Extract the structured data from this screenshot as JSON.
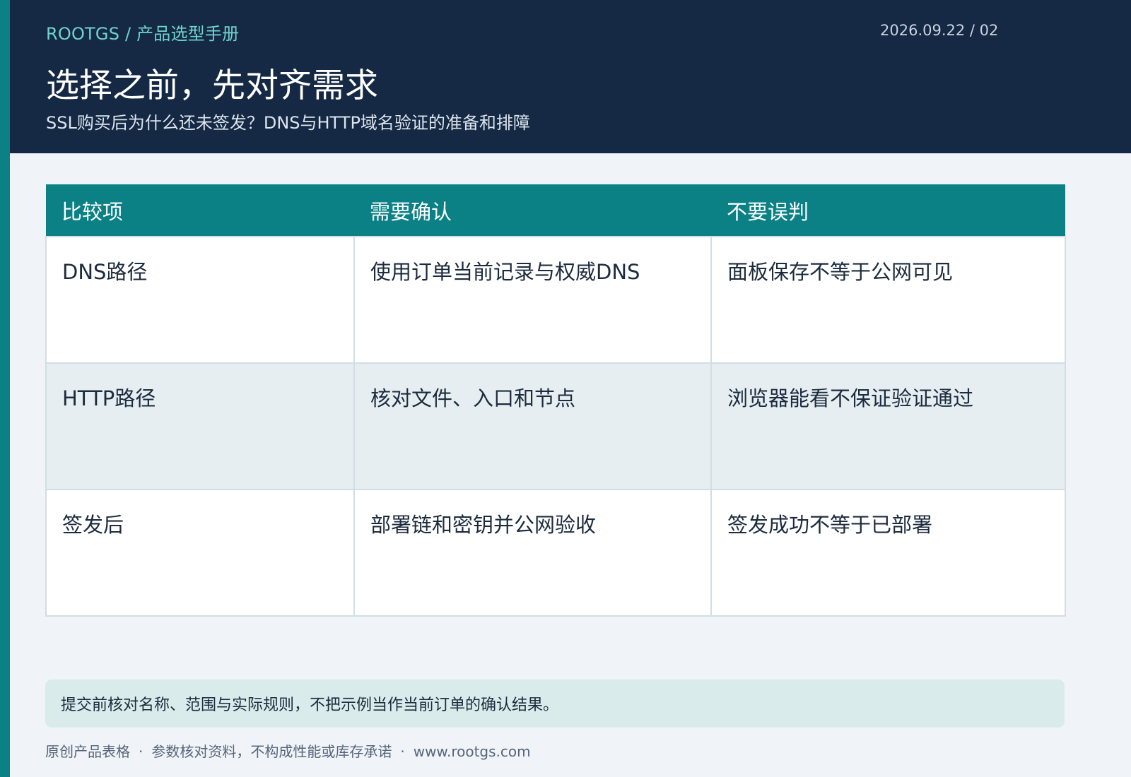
{
  "header": {
    "breadcrumb": "ROOTGS / 产品选型手册",
    "page_index": "2026.09.22 / 02",
    "title": "选择之前，先对齐需求",
    "subtitle": "SSL购买后为什么还未签发？DNS与HTTP域名验证的准备和排障"
  },
  "table": {
    "columns": [
      "比较项",
      "需要确认",
      "不要误判"
    ],
    "rows": [
      [
        "DNS路径",
        "使用订单当前记录与权威DNS",
        "面板保存不等于公网可见"
      ],
      [
        "HTTP路径",
        "核对文件、入口和节点",
        "浏览器能看不保证验证通过"
      ],
      [
        "签发后",
        "部署链和密钥并公网验收",
        "签发成功不等于已部署"
      ]
    ]
  },
  "note": "提交前核对名称、范围与实际规则，不把示例当作当前订单的确认结果。",
  "footer": {
    "items": [
      "原创产品表格",
      "参数核对资料，不构成性能或库存承诺",
      "www.rootgs.com"
    ],
    "separator": "·"
  },
  "colors": {
    "accent": "#0b8185",
    "header_bg": "#152944",
    "breadcrumb": "#6fd3cf"
  }
}
